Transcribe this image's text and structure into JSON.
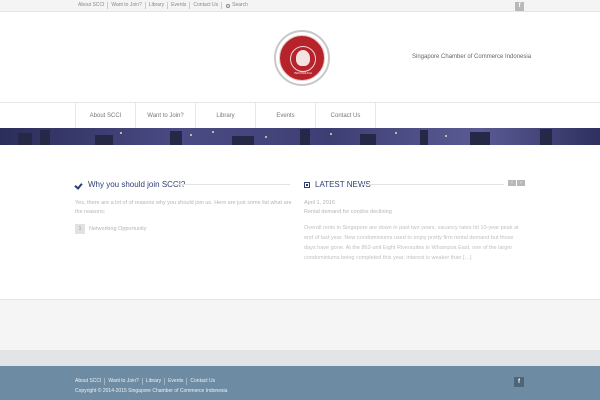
{
  "topbar": {
    "links": [
      "About SCCI",
      "Want to Join?",
      "Library",
      "Events",
      "Contact Us"
    ],
    "search_label": "Search",
    "facebook_glyph": "f"
  },
  "header": {
    "logo_text": "INDONESIA",
    "tagline": "Singapore Chamber of Commerce Indonesia"
  },
  "nav": {
    "items": [
      "About SCCI",
      "Want to Join?",
      "Library",
      "Events",
      "Contact Us"
    ]
  },
  "why": {
    "title": "Why you should join SCCI?",
    "lead": "Yes, there are a lot of of reasons why you should join us. Here are just some list what are the reasons:",
    "items": [
      {
        "num": "1",
        "label": "Networking Opportunity"
      }
    ]
  },
  "news": {
    "title": "LATEST NEWS",
    "prev_glyph": "‹",
    "next_glyph": "›",
    "date": "April 1, 2016",
    "headline": "Rental demand for condos declining",
    "body": "Overall rents in Singapore are down in past two years, vacancy rates hit 10-year peak at end of last year. New condominiums used to enjoy pretty firm rental demand but those days have gone. At the 862-unit Eight Riversuites in Whampoa East, one of the larger condominiums being completed this year, interest is weaker than […]"
  },
  "footer": {
    "links": [
      "About SCCI",
      "Want to Join?",
      "Library",
      "Events",
      "Contact Us"
    ],
    "copyright": "Copyright © 2014-2015 Singapore Chamber of Commerce Indonesia",
    "facebook_glyph": "f"
  },
  "colors": {
    "accent": "#2c3e73",
    "logo_red": "#b7232b",
    "footer": "#6d8ba3"
  }
}
